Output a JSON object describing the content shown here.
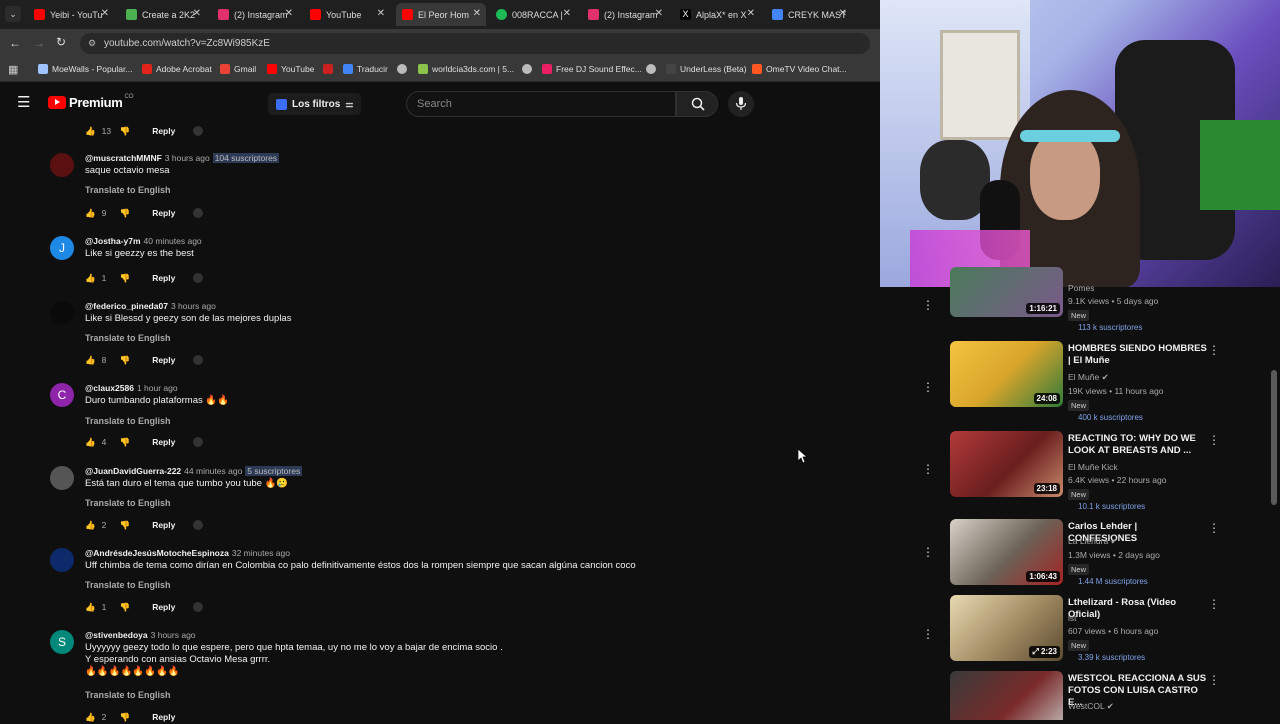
{
  "browser": {
    "tabs": [
      {
        "label": "Yeibi - YouTu",
        "color": "#ff0000"
      },
      {
        "label": "Create a 2K2",
        "color": "#4caf50"
      },
      {
        "label": "(2) Instagram",
        "color": "#e1306c"
      },
      {
        "label": "YouTube",
        "color": "#ff0000"
      },
      {
        "label": "El Peor Hom",
        "color": "#ff0000"
      },
      {
        "label": "008RACCA |",
        "color": "#1db954"
      },
      {
        "label": "(2) Instagram",
        "color": "#e1306c"
      },
      {
        "label": "AlplaX* en X",
        "color": "#ffffff"
      },
      {
        "label": "CREYK MAST",
        "color": "#4285f4"
      }
    ],
    "url": "youtube.com/watch?v=Zc8Wi985KzE",
    "bookmarks": [
      {
        "label": "MoeWalls - Popular...",
        "color": "#9ec3ff"
      },
      {
        "label": "Adobe Acrobat",
        "color": "#e2231a"
      },
      {
        "label": "Gmail",
        "color": "#ea4335"
      },
      {
        "label": "YouTube",
        "color": "#ff0000"
      },
      {
        "label": "Traducir",
        "color": "#4285f4"
      },
      {
        "label": "worldcia3ds.com | 5...",
        "color": "#8bc34a"
      },
      {
        "label": "Free DJ Sound Effec...",
        "color": "#e91e63"
      },
      {
        "label": "UnderLess (Beta)",
        "color": "#bbbbbb"
      },
      {
        "label": "OmeTV Video Chat...",
        "color": "#ff5722"
      }
    ]
  },
  "youtube": {
    "logo_text": "Premium",
    "country": "CO",
    "filters_label": "Los filtros",
    "search_placeholder": "Search"
  },
  "comments": [
    {
      "handle": "",
      "ago": "",
      "subs": "",
      "text": "",
      "translate": "",
      "likes": "13",
      "reply": "Reply",
      "avatar_color": "#000"
    },
    {
      "handle": "@muscratchMMNF",
      "ago": "3 hours ago",
      "subs": "104 suscriptores",
      "text": "saque octavio mesa",
      "translate": "Translate to English",
      "likes": "9",
      "reply": "Reply",
      "avatar_color": "#5a1010",
      "avatar_letter": ""
    },
    {
      "handle": "@Jostha-y7m",
      "ago": "40 minutes ago",
      "subs": "",
      "text": "Like si geezzy es the best",
      "translate": "",
      "likes": "1",
      "reply": "Reply",
      "avatar_color": "#1e88e5",
      "avatar_letter": "J"
    },
    {
      "handle": "@federico_pineda07",
      "ago": "3 hours ago",
      "subs": "",
      "text": "Like si Blessd y geezy son de las mejores duplas",
      "translate": "Translate to English",
      "likes": "8",
      "reply": "Reply",
      "avatar_color": "#0a0a0a",
      "avatar_letter": ""
    },
    {
      "handle": "@claux2586",
      "ago": "1 hour ago",
      "subs": "",
      "text": "Duro tumbando plataformas 🔥🔥",
      "translate": "Translate to English",
      "likes": "4",
      "reply": "Reply",
      "avatar_color": "#8e24aa",
      "avatar_letter": "C"
    },
    {
      "handle": "@JuanDavidGuerra-222",
      "ago": "44 minutes ago",
      "subs": "5 suscriptores",
      "text": "Está tan duro el tema que tumbo you tube 🔥🥲",
      "translate": "Translate to English",
      "likes": "2",
      "reply": "Reply",
      "avatar_color": "#555",
      "avatar_letter": ""
    },
    {
      "handle": "@AndrésdeJesúsMotocheEspinoza",
      "ago": "32 minutes ago",
      "subs": "",
      "text": "Uff chimba de tema como dirían en Colombia co palo definitivamente éstos dos la rompen siempre que sacan algúna cancion coco",
      "translate": "Translate to English",
      "likes": "1",
      "reply": "Reply",
      "avatar_color": "#0d2a6b",
      "avatar_letter": ""
    },
    {
      "handle": "@stivenbedoya",
      "ago": "3 hours ago",
      "subs": "",
      "text": "Uyyyyyy geezy todo lo que espere, pero que hpta temaa, uy no me lo voy a bajar de encima socio .",
      "text2": "Y esperando con ansias Octavio Mesa grrrr.",
      "text3": "🔥🔥🔥🔥🔥🔥🔥🔥",
      "translate": "Translate to English",
      "likes": "2",
      "reply": "Reply",
      "avatar_color": "#00897b",
      "avatar_letter": "S"
    }
  ],
  "sidebar": {
    "videos": [
      {
        "title": "",
        "channel": "Pomes",
        "meta": "9.1K views • 5 days ago",
        "badge": "New",
        "subs": "113 k suscriptores",
        "duration": "1:16:21",
        "color": "#6b4c7a"
      },
      {
        "title": "HOMBRES SIENDO HOMBRES | El Muñe",
        "channel": "El Muñe",
        "meta": "19K views • 11 hours ago",
        "badge": "New",
        "subs": "400 k suscriptores",
        "duration": "24:08",
        "color": "#d9a52a"
      },
      {
        "title": "REACTING TO: WHY DO WE LOOK AT BREASTS AND ...",
        "channel": "El Muñe Kick",
        "meta": "6.4K views • 22 hours ago",
        "badge": "New",
        "subs": "10.1 k suscriptores",
        "duration": "23:18",
        "color": "#8a2b2b"
      },
      {
        "title": "Carlos Lehder | CONFESIONES",
        "channel": "La Liendra",
        "meta": "1.3M views • 2 days ago",
        "badge": "New",
        "subs": "1.44 M suscriptores",
        "duration": "1:06:43",
        "color": "#5b5248"
      },
      {
        "title": "Lthelizard - Rosa (Video Oficial)",
        "channel": "lst",
        "meta": "607 views • 6 hours ago",
        "badge": "New",
        "subs": "3.39 k suscriptores",
        "duration": "2:23",
        "color": "#a08a62"
      },
      {
        "title": "WESTCOL REACCIONA A SUS FOTOS CON LUISA CASTRO E...",
        "channel": "WestCOL",
        "meta": "",
        "badge": "",
        "subs": "",
        "duration": "",
        "color": "#7a2a2a"
      }
    ]
  }
}
